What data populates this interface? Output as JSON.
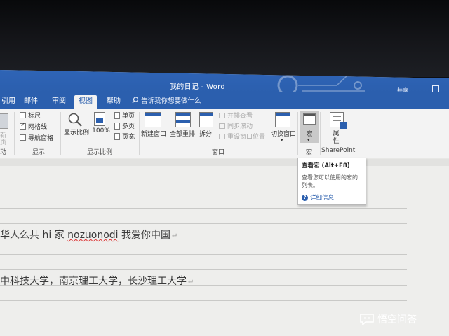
{
  "window": {
    "title": "我的日记 - Word",
    "share_label": "共享"
  },
  "tabs": [
    {
      "label": "引用",
      "active": false
    },
    {
      "label": "邮件",
      "active": false
    },
    {
      "label": "审阅",
      "active": false
    },
    {
      "label": "视图",
      "active": true
    },
    {
      "label": "帮助",
      "active": false
    }
  ],
  "tell_me": {
    "placeholder": "告诉我你想要做什么"
  },
  "ribbon": {
    "views_group": {
      "label": "动",
      "item1": "新",
      "item2": "页"
    },
    "show_group": {
      "label": "显示",
      "ruler": {
        "label": "标尺",
        "checked": false
      },
      "gridlines": {
        "label": "网格线",
        "checked": true
      },
      "nav_pane": {
        "label": "导航窗格",
        "checked": false
      }
    },
    "zoom_group": {
      "label": "显示比例",
      "zoom_btn": "显示比例",
      "percent_btn": "100%",
      "one_page": "单页",
      "multi_page": "多页",
      "page_width": "页宽"
    },
    "window_group": {
      "label": "窗口",
      "new_window": "新建窗口",
      "arrange_all": "全部重排",
      "split": "拆分",
      "side_by_side": "并排查看",
      "sync_scroll": "同步滚动",
      "reset_position": "重设窗口位置",
      "switch_window": "切换窗口"
    },
    "macros_group": {
      "label": "宏",
      "macros_btn": "宏"
    },
    "sharepoint_group": {
      "label": "SharePoint",
      "properties_btn": "属\n性"
    }
  },
  "tooltip": {
    "title": "查看宏 (Alt+F8)",
    "description": "查看您可以使用的宏的列表。",
    "link": "详细信息"
  },
  "document": {
    "lines": [
      {
        "text_before": "华人么共 hi 家 ",
        "misspelled": "nozuonodi",
        "text_after": " 我爱你中国"
      },
      {
        "text_before": "中科技大学，南京理工大学，长沙理工大学",
        "misspelled": "",
        "text_after": ""
      }
    ]
  },
  "watermark": {
    "text": "悟空问答"
  },
  "colors": {
    "accent": "#2b5fae",
    "ribbon_bg": "#f3f3f3",
    "doc_bg": "#eeeeec"
  }
}
